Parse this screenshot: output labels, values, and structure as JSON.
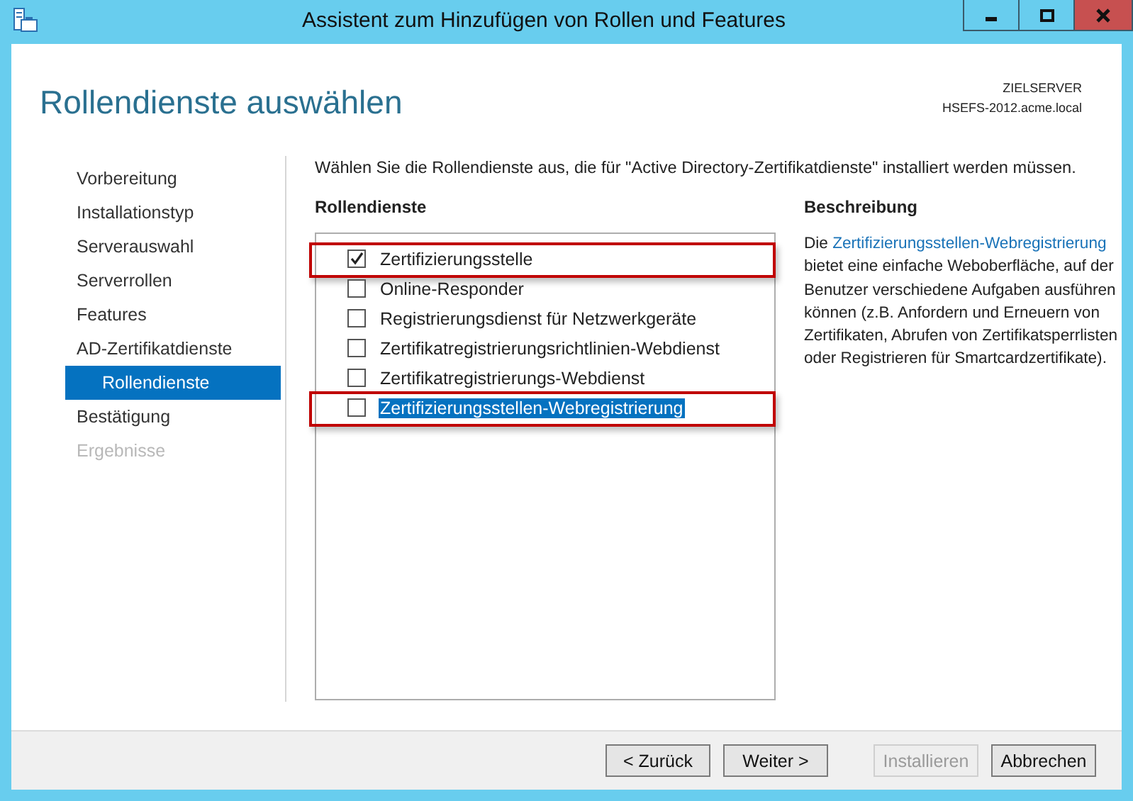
{
  "window": {
    "title": "Assistent zum Hinzufügen von Rollen und Features"
  },
  "header": {
    "title": "Rollendienste auswählen",
    "server_label": "ZIELSERVER",
    "server_name": "HSEFS-2012.acme.local"
  },
  "nav": [
    {
      "label": "Vorbereitung",
      "selected": false,
      "disabled": false
    },
    {
      "label": "Installationstyp",
      "selected": false,
      "disabled": false
    },
    {
      "label": "Serverauswahl",
      "selected": false,
      "disabled": false
    },
    {
      "label": "Serverrollen",
      "selected": false,
      "disabled": false
    },
    {
      "label": "Features",
      "selected": false,
      "disabled": false
    },
    {
      "label": "AD-Zertifikatdienste",
      "selected": false,
      "disabled": false,
      "children": [
        {
          "label": "Rollendienste",
          "selected": true,
          "disabled": false
        }
      ]
    },
    {
      "label": "Bestätigung",
      "selected": false,
      "disabled": false
    },
    {
      "label": "Ergebnisse",
      "selected": false,
      "disabled": true
    }
  ],
  "intro": "Wählen Sie die Rollendienste aus, die für \"Active Directory-Zertifikatdienste\" installiert werden müssen.",
  "role_services": {
    "heading": "Rollendienste",
    "items": [
      {
        "label": "Zertifizierungsstelle",
        "checked": true,
        "selected": false,
        "highlighted": true
      },
      {
        "label": "Online-Responder",
        "checked": false,
        "selected": false,
        "highlighted": false
      },
      {
        "label": "Registrierungsdienst für Netzwerkgeräte",
        "checked": false,
        "selected": false,
        "highlighted": false
      },
      {
        "label": "Zertifikatregistrierungsrichtlinien-Webdienst",
        "checked": false,
        "selected": false,
        "highlighted": false
      },
      {
        "label": "Zertifikatregistrierungs-Webdienst",
        "checked": false,
        "selected": false,
        "highlighted": false
      },
      {
        "label": "Zertifizierungsstellen-Webregistrierung",
        "checked": false,
        "selected": true,
        "highlighted": true
      }
    ]
  },
  "description": {
    "heading": "Beschreibung",
    "prefix": "Die",
    "link": "Zertifizierungsstellen-Webregistrierung",
    "suffix": "bietet eine einfache Weboberfläche, auf der Benutzer verschiedene Aufgaben ausführen können (z.B. Anfordern und Erneuern von Zertifikaten, Abrufen von Zertifikatsperrlisten oder Registrieren für Smartcardzertifikate)."
  },
  "buttons": [
    {
      "label": "< Zurück",
      "disabled": false
    },
    {
      "label": "Weiter >",
      "disabled": false
    },
    {
      "label": "Installieren",
      "disabled": true
    },
    {
      "label": "Abbrechen",
      "disabled": false
    }
  ]
}
